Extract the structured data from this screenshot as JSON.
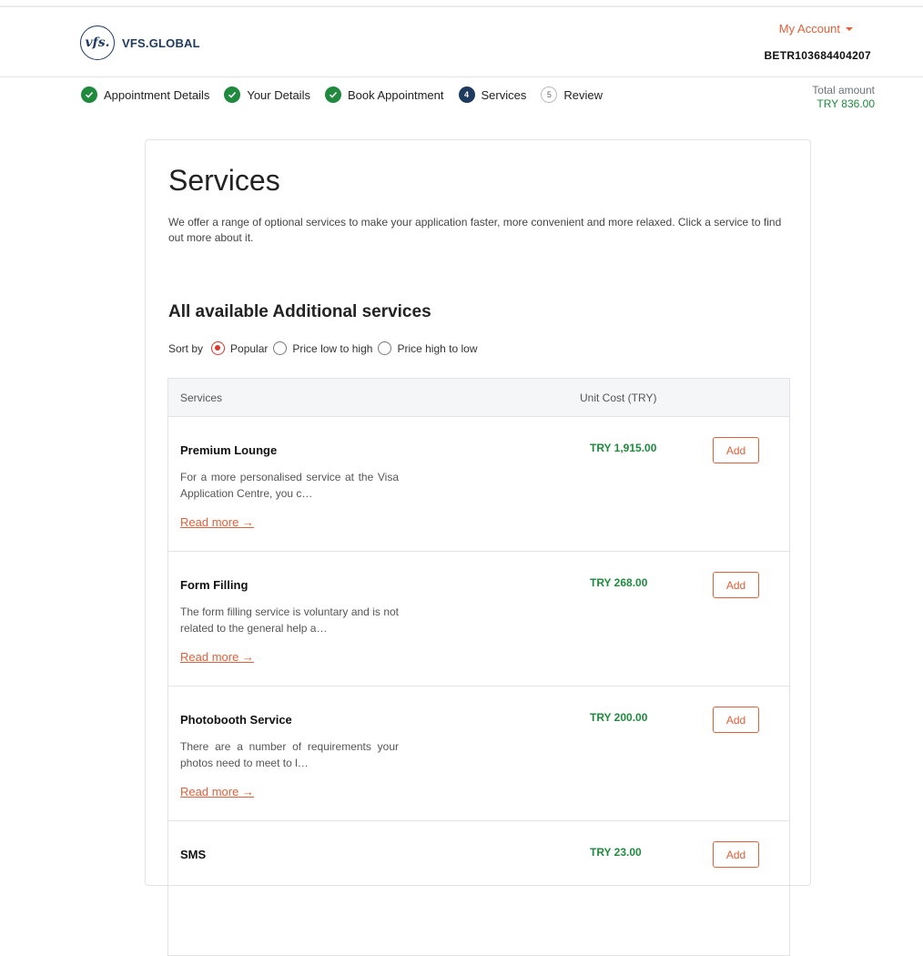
{
  "header": {
    "logo_mark": "vfs.",
    "logo_text": "VFS.GLOBAL",
    "account_label": "My Account",
    "reference": "BETR103684404207"
  },
  "stepper": {
    "steps": [
      {
        "label": "Appointment Details",
        "state": "done"
      },
      {
        "label": "Your Details",
        "state": "done"
      },
      {
        "label": "Book Appointment",
        "state": "done"
      },
      {
        "label": "Services",
        "state": "current",
        "number": "4"
      },
      {
        "label": "Review",
        "state": "pending",
        "number": "5"
      }
    ],
    "total_label": "Total amount",
    "total_amount": "TRY 836.00"
  },
  "main": {
    "title": "Services",
    "intro": "We offer a range of optional services to make your application faster, more convenient and more relaxed. Click a service to find out more about it.",
    "section_title": "All available Additional services",
    "sort": {
      "label": "Sort by",
      "options": [
        "Popular",
        "Price low to high",
        "Price high to low"
      ],
      "selected": "Popular"
    },
    "table": {
      "headers": [
        "Services",
        "Unit Cost (TRY)"
      ],
      "rows": [
        {
          "name": "Premium Lounge",
          "desc": "For a more personalised service at the Visa Application Centre, you c…",
          "price": "TRY 1,915.00",
          "action": "Add",
          "link": "Read more →"
        },
        {
          "name": "Form Filling",
          "desc": "The form filling service is voluntary and is not related to the general help a…",
          "price": "TRY 268.00",
          "action": "Add",
          "link": "Read more →"
        },
        {
          "name": "Photobooth Service",
          "desc": "There are a number of requirements your photos need to meet to l…",
          "price": "TRY 200.00",
          "action": "Add",
          "link": "Read more →"
        },
        {
          "name": "SMS",
          "desc": "",
          "price": "TRY 23.00",
          "action": "Add",
          "link": ""
        }
      ]
    }
  },
  "colors": {
    "brand_navy": "#1e3a5f",
    "accent_orange": "#e0603a",
    "success_green": "#1f8a3d",
    "radio_red": "#d9372b"
  }
}
